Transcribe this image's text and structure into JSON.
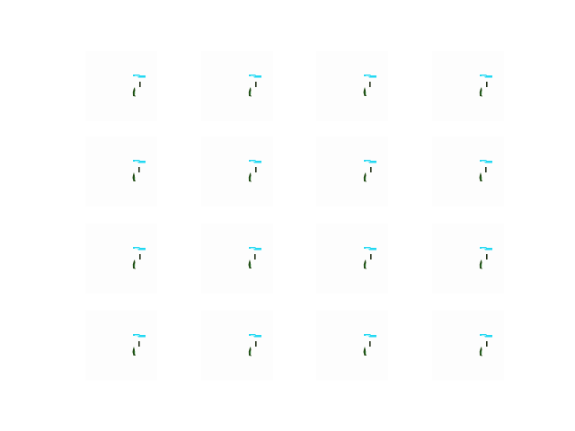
{
  "figure": {
    "background_color": "#ffffff",
    "tile_background_color": "#fdfdfd",
    "grid": {
      "rows": 4,
      "columns": 4
    },
    "palette": {
      "cyan": "#22d8f2",
      "light_cyan": "#9ef0fb",
      "dark_green": "#1f4a12",
      "green": "#2e7d32",
      "dark": "#233018"
    },
    "tiles": [
      {
        "row": 0,
        "col": 0,
        "variant": "a"
      },
      {
        "row": 0,
        "col": 1,
        "variant": "a"
      },
      {
        "row": 0,
        "col": 2,
        "variant": "b"
      },
      {
        "row": 0,
        "col": 3,
        "variant": "a"
      },
      {
        "row": 1,
        "col": 0,
        "variant": "b"
      },
      {
        "row": 1,
        "col": 1,
        "variant": "a"
      },
      {
        "row": 1,
        "col": 2,
        "variant": "a"
      },
      {
        "row": 1,
        "col": 3,
        "variant": "b"
      },
      {
        "row": 2,
        "col": 0,
        "variant": "a"
      },
      {
        "row": 2,
        "col": 1,
        "variant": "b"
      },
      {
        "row": 2,
        "col": 2,
        "variant": "a"
      },
      {
        "row": 2,
        "col": 3,
        "variant": "a"
      },
      {
        "row": 3,
        "col": 0,
        "variant": "b"
      },
      {
        "row": 3,
        "col": 1,
        "variant": "a"
      },
      {
        "row": 3,
        "col": 2,
        "variant": "b"
      },
      {
        "row": 3,
        "col": 3,
        "variant": "a"
      }
    ]
  }
}
